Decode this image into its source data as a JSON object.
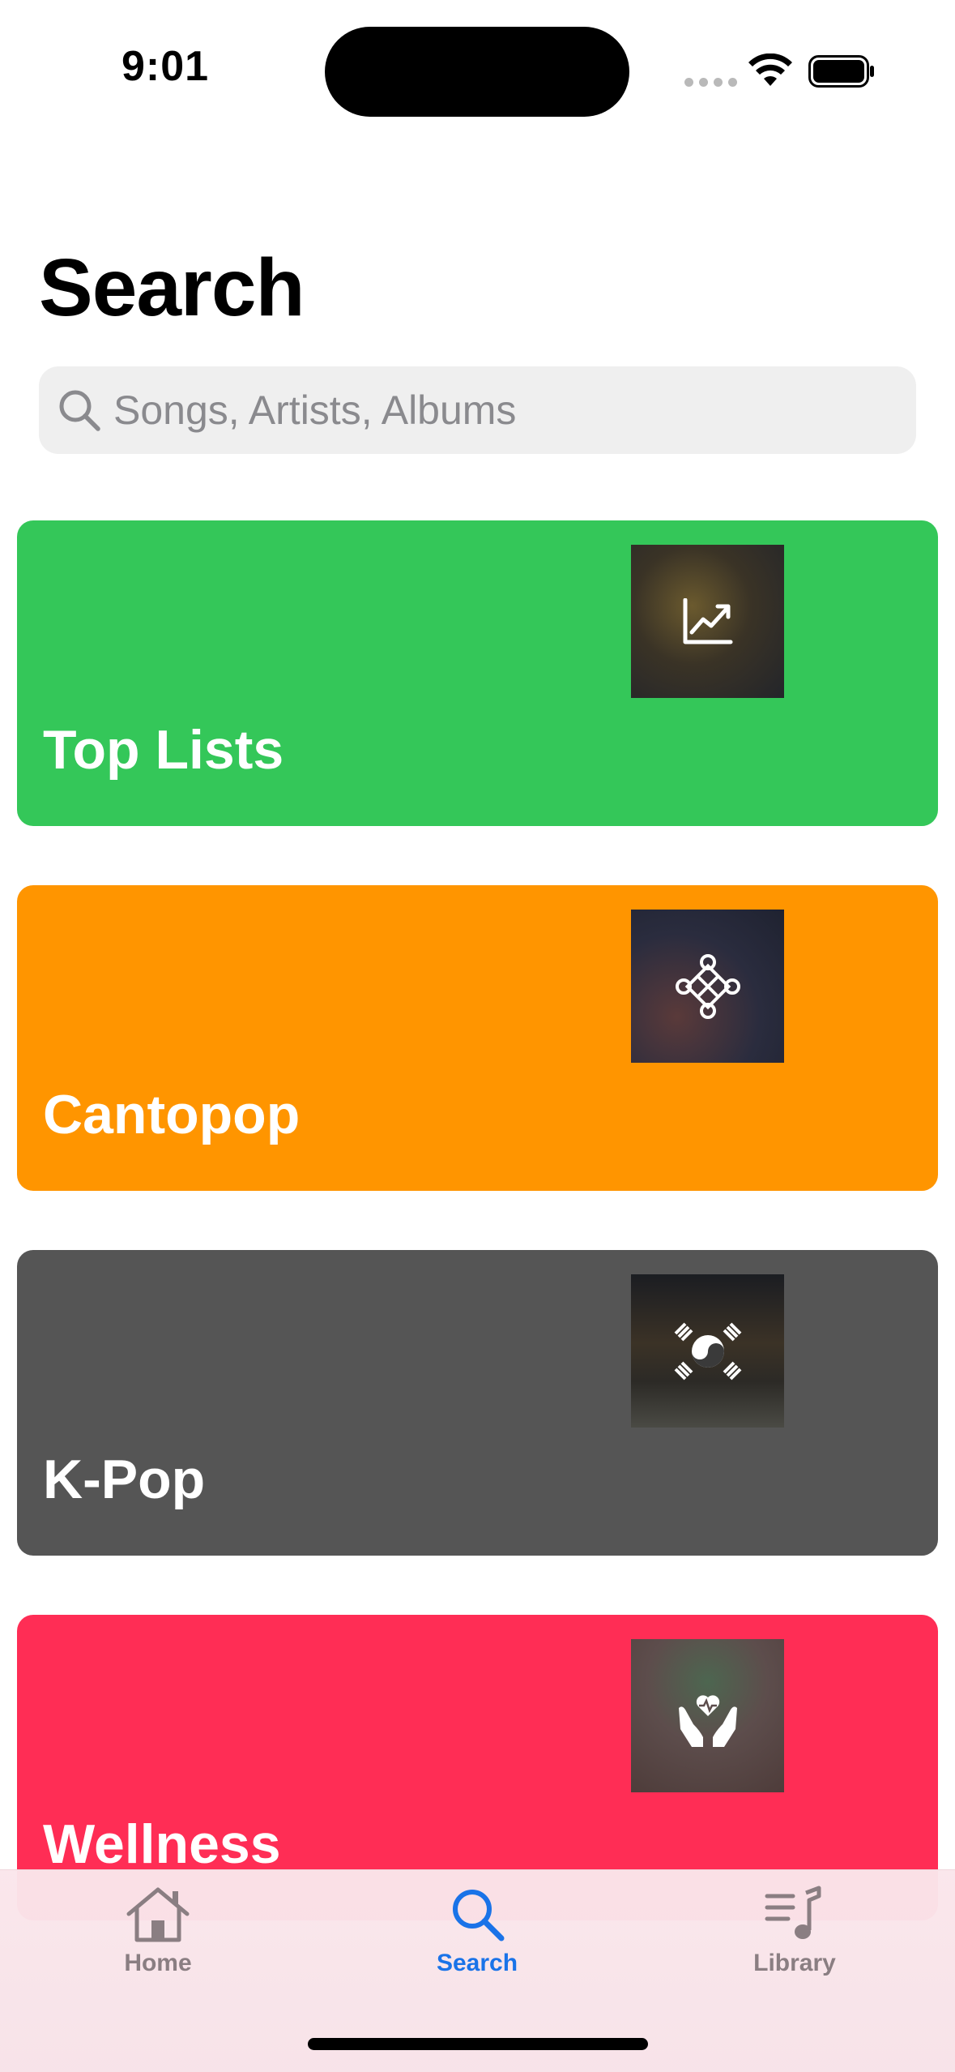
{
  "status_bar": {
    "time": "9:01"
  },
  "header": {
    "title": "Search"
  },
  "search": {
    "placeholder": "Songs, Artists, Albums",
    "value": ""
  },
  "categories": [
    {
      "label": "Top Lists",
      "color": "#34c759",
      "icon": "trending-chart-icon"
    },
    {
      "label": "Cantopop",
      "color": "#ff9500",
      "icon": "endless-knot-icon"
    },
    {
      "label": "K-Pop",
      "color": "#555555",
      "icon": "taeguk-flag-icon"
    },
    {
      "label": "Wellness",
      "color": "#ff2d55",
      "icon": "heart-hands-icon"
    }
  ],
  "tab_bar": {
    "tabs": [
      {
        "label": "Home",
        "icon": "house-icon",
        "selected": false
      },
      {
        "label": "Search",
        "icon": "search-icon",
        "selected": true
      },
      {
        "label": "Library",
        "icon": "music-list-icon",
        "selected": false
      }
    ],
    "active_color": "#1a73e8",
    "inactive_color": "#8a7e82"
  }
}
